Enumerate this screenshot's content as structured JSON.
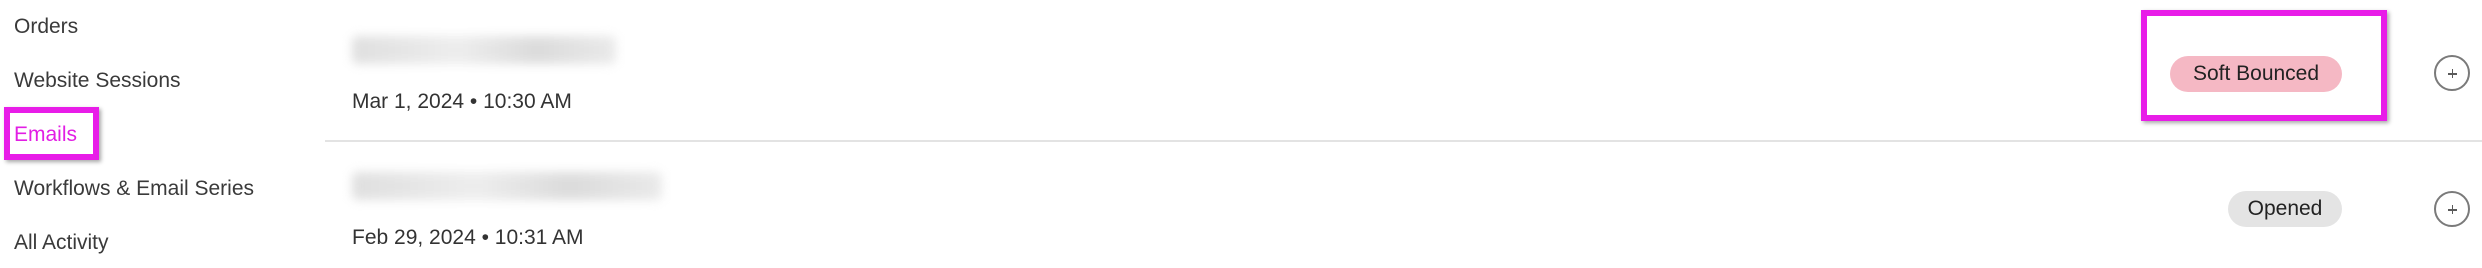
{
  "sidebar": {
    "items": [
      {
        "label": "Orders"
      },
      {
        "label": "Website Sessions"
      },
      {
        "label": "Emails"
      },
      {
        "label": "Workflows & Email Series"
      },
      {
        "label": "All Activity"
      }
    ]
  },
  "emails": {
    "rows": [
      {
        "date": "Mar 1, 2024 • 10:30 AM",
        "status": "Soft Bounced"
      },
      {
        "date": "Feb 29, 2024 • 10:31 AM",
        "status": "Opened"
      }
    ]
  },
  "colors": {
    "active": "#e21ee4",
    "highlight": "#e81de8",
    "soft_bounced_bg": "#f5b8c4",
    "opened_bg": "#e4e4e4"
  },
  "icons": {
    "row_action": "plus-circle-icon"
  }
}
